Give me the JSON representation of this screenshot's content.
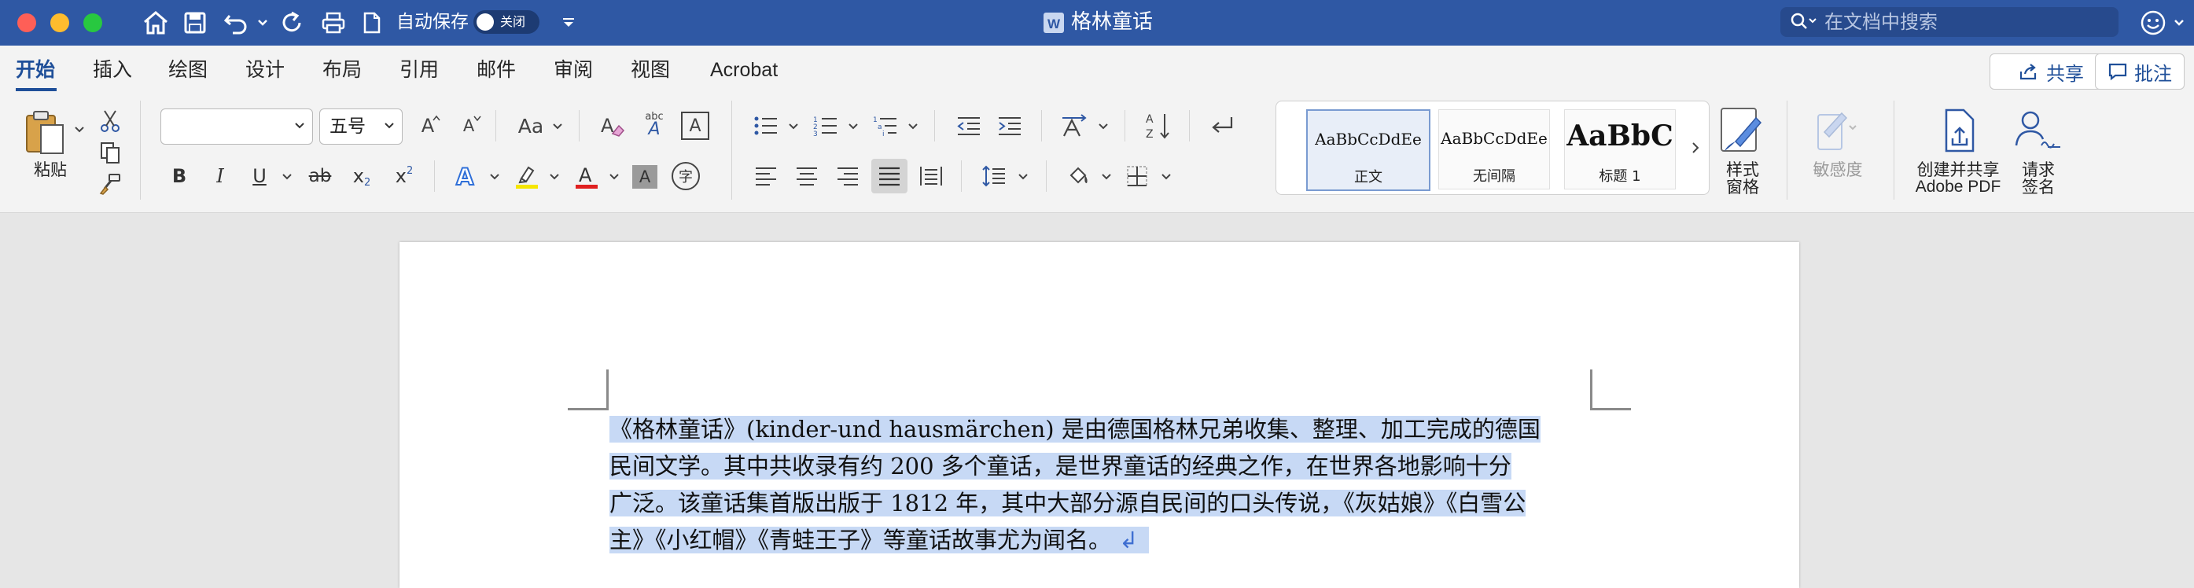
{
  "window": {
    "title": "格林童话",
    "autosave_label": "自动保存",
    "autosave_state": "关闭",
    "search_placeholder": "在文档中搜索"
  },
  "ribbon": {
    "tabs": [
      "开始",
      "插入",
      "绘图",
      "设计",
      "布局",
      "引用",
      "邮件",
      "审阅",
      "视图",
      "Acrobat"
    ],
    "share_label": "共享",
    "comments_label": "批注",
    "paste_label": "粘贴",
    "font_name": "",
    "font_size": "五号",
    "buttons": {
      "grow_font": "A",
      "shrink_font": "A",
      "change_case": "Aa",
      "bold": "B",
      "italic": "I",
      "underline": "U",
      "strikethrough": "ab",
      "subscript": "x",
      "superscript": "x",
      "phonetic_char": "字",
      "phonetic_top": "abc",
      "char_border": "A"
    },
    "styles": [
      {
        "preview": "AaBbCcDdEe",
        "name": "正文"
      },
      {
        "preview": "AaBbCcDdEe",
        "name": "无间隔"
      },
      {
        "preview": "AaBbC",
        "name": "标题 1"
      }
    ],
    "styles_pane_label": [
      "样式",
      "窗格"
    ],
    "sensitivity_label": "敏感度",
    "adobe_label": [
      "创建并共享",
      "Adobe PDF"
    ],
    "sign_label": [
      "请求",
      "签名"
    ],
    "colors": {
      "accent": "#2f58a4",
      "highlight": "#f6e600",
      "font_color": "#e02020"
    }
  },
  "document": {
    "lines": [
      "《格林童话》(kinder-und hausmärchen) 是由德国格林兄弟收集、整理、加工完成的德国",
      "民间文学。其中共收录有约  200  多个童话，是世界童话的经典之作，在世界各地影响十分",
      "广泛。该童话集首版出版于 1812 年，其中大部分源自民间的口头传说，《灰姑娘》《白雪公",
      "主》《小红帽》《青蛙王子》等童话故事尤为闻名。"
    ],
    "paragraph_mark": "↲"
  }
}
